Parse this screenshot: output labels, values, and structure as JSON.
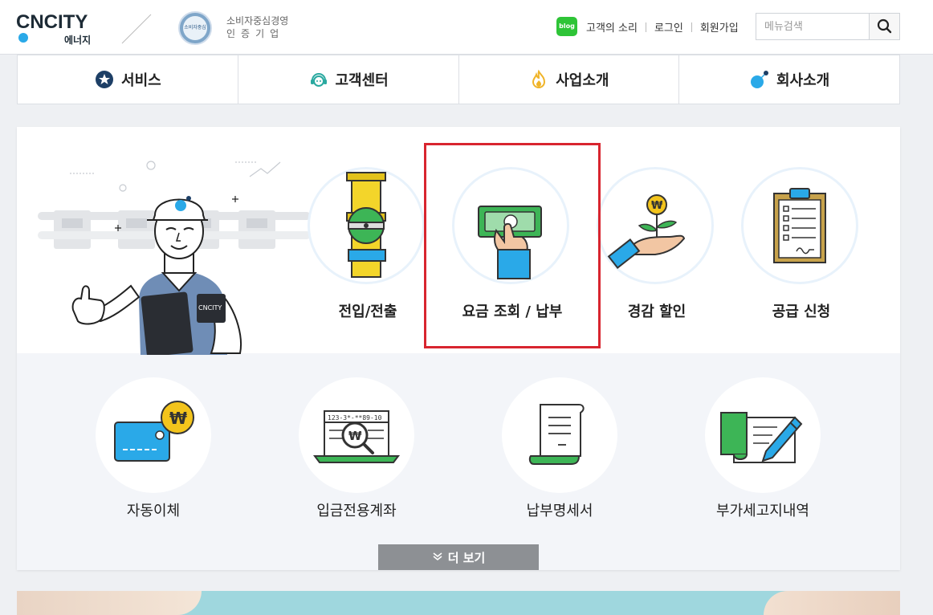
{
  "header": {
    "logo_text": "CNCITY",
    "logo_sub": "에너지",
    "cert_badge_text": "소비자중심",
    "cert_line1": "소비자중심경영",
    "cert_line2": "인증기업",
    "blog_label": "blog",
    "links": [
      "고객의 소리",
      "로그인",
      "회원가입"
    ],
    "search_placeholder": "메뉴검색"
  },
  "nav": {
    "items": [
      {
        "label": "서비스",
        "icon": "star-badge-icon"
      },
      {
        "label": "고객센터",
        "icon": "headset-icon"
      },
      {
        "label": "사업소개",
        "icon": "flame-icon"
      },
      {
        "label": "회사소개",
        "icon": "company-dot-icon"
      }
    ]
  },
  "hero": {
    "badge_text": "CNCITY"
  },
  "services_top": [
    {
      "label": "전입/전출",
      "icon": "gas-pipe-icon"
    },
    {
      "label": "요금 조회 / 납부",
      "icon": "hand-money-icon"
    },
    {
      "label": "경감 할인",
      "icon": "hand-plant-coin-icon"
    },
    {
      "label": "공급 신청",
      "icon": "clipboard-icon"
    }
  ],
  "services_bottom": [
    {
      "label": "자동이체",
      "icon": "card-won-icon"
    },
    {
      "label": "입금전용계좌",
      "icon": "laptop-search-icon"
    },
    {
      "label": "납부명세서",
      "icon": "receipt-icon"
    },
    {
      "label": "부가세고지내역",
      "icon": "form-pen-icon"
    }
  ],
  "account_sample": "123-3*-**89-10",
  "more_label": "더 보기",
  "colors": {
    "highlight": "#d8252f",
    "brand_blue": "#2aa9e8",
    "more_button": "#8d9094"
  }
}
